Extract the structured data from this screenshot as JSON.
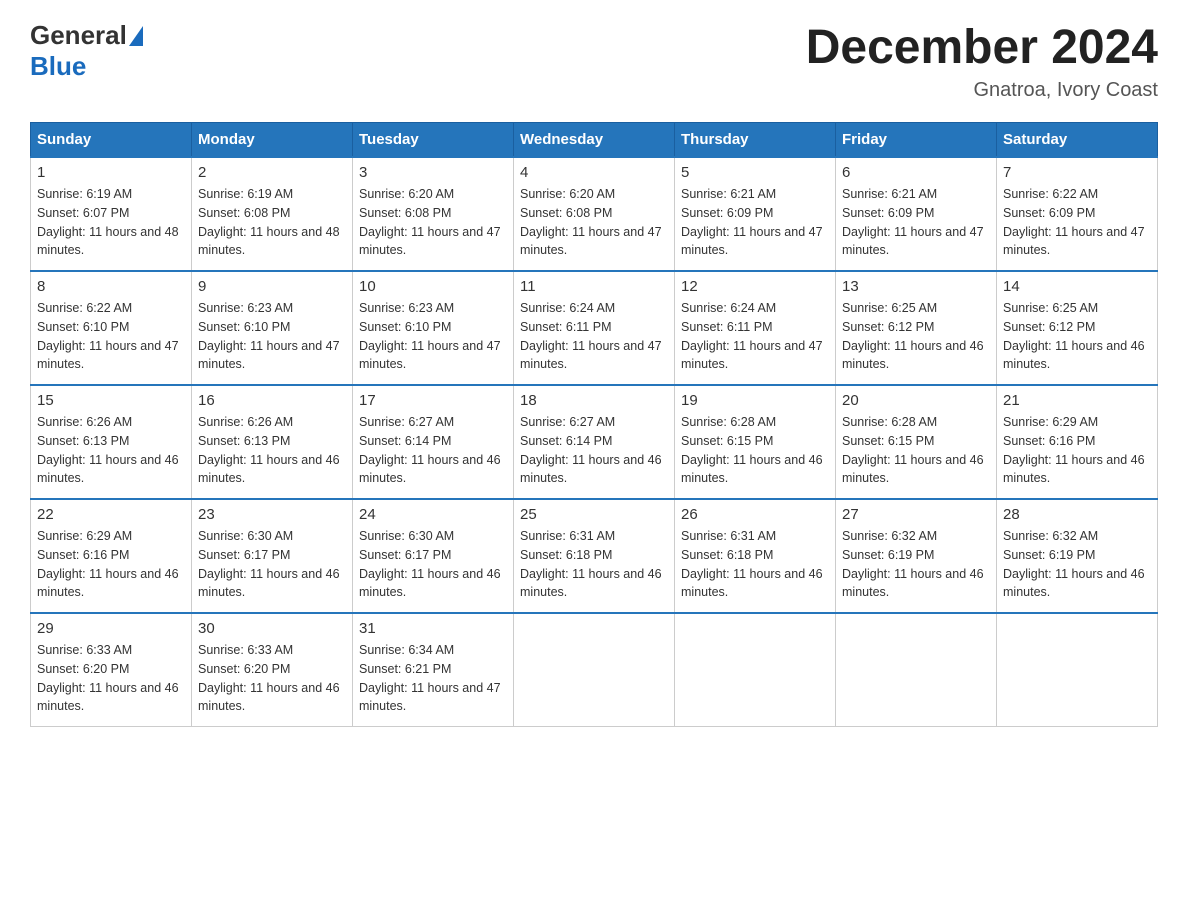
{
  "header": {
    "logo_general": "General",
    "logo_blue": "Blue",
    "month_title": "December 2024",
    "location": "Gnatroa, Ivory Coast"
  },
  "weekdays": [
    "Sunday",
    "Monday",
    "Tuesday",
    "Wednesday",
    "Thursday",
    "Friday",
    "Saturday"
  ],
  "weeks": [
    [
      {
        "day": "1",
        "sunrise": "6:19 AM",
        "sunset": "6:07 PM",
        "daylight": "11 hours and 48 minutes."
      },
      {
        "day": "2",
        "sunrise": "6:19 AM",
        "sunset": "6:08 PM",
        "daylight": "11 hours and 48 minutes."
      },
      {
        "day": "3",
        "sunrise": "6:20 AM",
        "sunset": "6:08 PM",
        "daylight": "11 hours and 47 minutes."
      },
      {
        "day": "4",
        "sunrise": "6:20 AM",
        "sunset": "6:08 PM",
        "daylight": "11 hours and 47 minutes."
      },
      {
        "day": "5",
        "sunrise": "6:21 AM",
        "sunset": "6:09 PM",
        "daylight": "11 hours and 47 minutes."
      },
      {
        "day": "6",
        "sunrise": "6:21 AM",
        "sunset": "6:09 PM",
        "daylight": "11 hours and 47 minutes."
      },
      {
        "day": "7",
        "sunrise": "6:22 AM",
        "sunset": "6:09 PM",
        "daylight": "11 hours and 47 minutes."
      }
    ],
    [
      {
        "day": "8",
        "sunrise": "6:22 AM",
        "sunset": "6:10 PM",
        "daylight": "11 hours and 47 minutes."
      },
      {
        "day": "9",
        "sunrise": "6:23 AM",
        "sunset": "6:10 PM",
        "daylight": "11 hours and 47 minutes."
      },
      {
        "day": "10",
        "sunrise": "6:23 AM",
        "sunset": "6:10 PM",
        "daylight": "11 hours and 47 minutes."
      },
      {
        "day": "11",
        "sunrise": "6:24 AM",
        "sunset": "6:11 PM",
        "daylight": "11 hours and 47 minutes."
      },
      {
        "day": "12",
        "sunrise": "6:24 AM",
        "sunset": "6:11 PM",
        "daylight": "11 hours and 47 minutes."
      },
      {
        "day": "13",
        "sunrise": "6:25 AM",
        "sunset": "6:12 PM",
        "daylight": "11 hours and 46 minutes."
      },
      {
        "day": "14",
        "sunrise": "6:25 AM",
        "sunset": "6:12 PM",
        "daylight": "11 hours and 46 minutes."
      }
    ],
    [
      {
        "day": "15",
        "sunrise": "6:26 AM",
        "sunset": "6:13 PM",
        "daylight": "11 hours and 46 minutes."
      },
      {
        "day": "16",
        "sunrise": "6:26 AM",
        "sunset": "6:13 PM",
        "daylight": "11 hours and 46 minutes."
      },
      {
        "day": "17",
        "sunrise": "6:27 AM",
        "sunset": "6:14 PM",
        "daylight": "11 hours and 46 minutes."
      },
      {
        "day": "18",
        "sunrise": "6:27 AM",
        "sunset": "6:14 PM",
        "daylight": "11 hours and 46 minutes."
      },
      {
        "day": "19",
        "sunrise": "6:28 AM",
        "sunset": "6:15 PM",
        "daylight": "11 hours and 46 minutes."
      },
      {
        "day": "20",
        "sunrise": "6:28 AM",
        "sunset": "6:15 PM",
        "daylight": "11 hours and 46 minutes."
      },
      {
        "day": "21",
        "sunrise": "6:29 AM",
        "sunset": "6:16 PM",
        "daylight": "11 hours and 46 minutes."
      }
    ],
    [
      {
        "day": "22",
        "sunrise": "6:29 AM",
        "sunset": "6:16 PM",
        "daylight": "11 hours and 46 minutes."
      },
      {
        "day": "23",
        "sunrise": "6:30 AM",
        "sunset": "6:17 PM",
        "daylight": "11 hours and 46 minutes."
      },
      {
        "day": "24",
        "sunrise": "6:30 AM",
        "sunset": "6:17 PM",
        "daylight": "11 hours and 46 minutes."
      },
      {
        "day": "25",
        "sunrise": "6:31 AM",
        "sunset": "6:18 PM",
        "daylight": "11 hours and 46 minutes."
      },
      {
        "day": "26",
        "sunrise": "6:31 AM",
        "sunset": "6:18 PM",
        "daylight": "11 hours and 46 minutes."
      },
      {
        "day": "27",
        "sunrise": "6:32 AM",
        "sunset": "6:19 PM",
        "daylight": "11 hours and 46 minutes."
      },
      {
        "day": "28",
        "sunrise": "6:32 AM",
        "sunset": "6:19 PM",
        "daylight": "11 hours and 46 minutes."
      }
    ],
    [
      {
        "day": "29",
        "sunrise": "6:33 AM",
        "sunset": "6:20 PM",
        "daylight": "11 hours and 46 minutes."
      },
      {
        "day": "30",
        "sunrise": "6:33 AM",
        "sunset": "6:20 PM",
        "daylight": "11 hours and 46 minutes."
      },
      {
        "day": "31",
        "sunrise": "6:34 AM",
        "sunset": "6:21 PM",
        "daylight": "11 hours and 47 minutes."
      },
      null,
      null,
      null,
      null
    ]
  ]
}
